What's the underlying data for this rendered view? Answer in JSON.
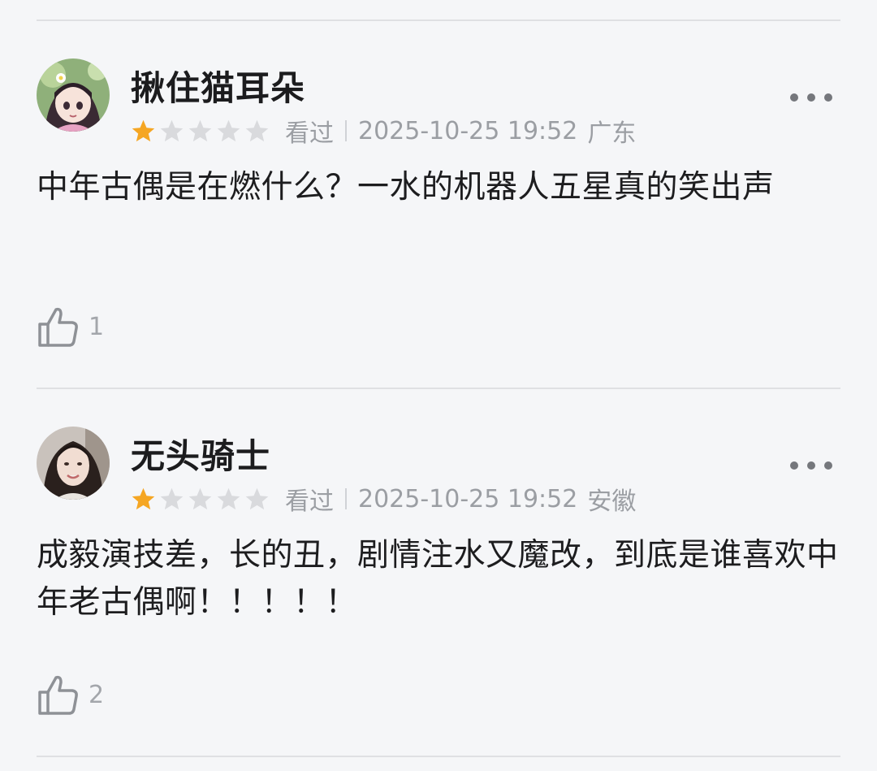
{
  "reviews": [
    {
      "username": "揪住猫耳朵",
      "rating": 1,
      "rating_max": 5,
      "status": "看过",
      "datetime": "2025-10-25 19:52",
      "location": "广东",
      "comment": "中年古偶是在燃什么？一水的机器人五星真的笑出声",
      "likes": "1",
      "avatar_icon": "anime-avatar-icon"
    },
    {
      "username": "无头骑士",
      "rating": 1,
      "rating_max": 5,
      "status": "看过",
      "datetime": "2025-10-25 19:52",
      "location": "安徽",
      "comment": "成毅演技差，长的丑，剧情注水又魔改，到底是谁喜欢中年老古偶啊！！！！！",
      "likes": "2",
      "avatar_icon": "photo-avatar-icon"
    }
  ],
  "colors": {
    "star_filled": "#f5a623",
    "star_empty": "#d9dadd",
    "text_primary": "#1d1d1f",
    "text_secondary": "#9b9ea3",
    "background": "#f5f6f8"
  }
}
